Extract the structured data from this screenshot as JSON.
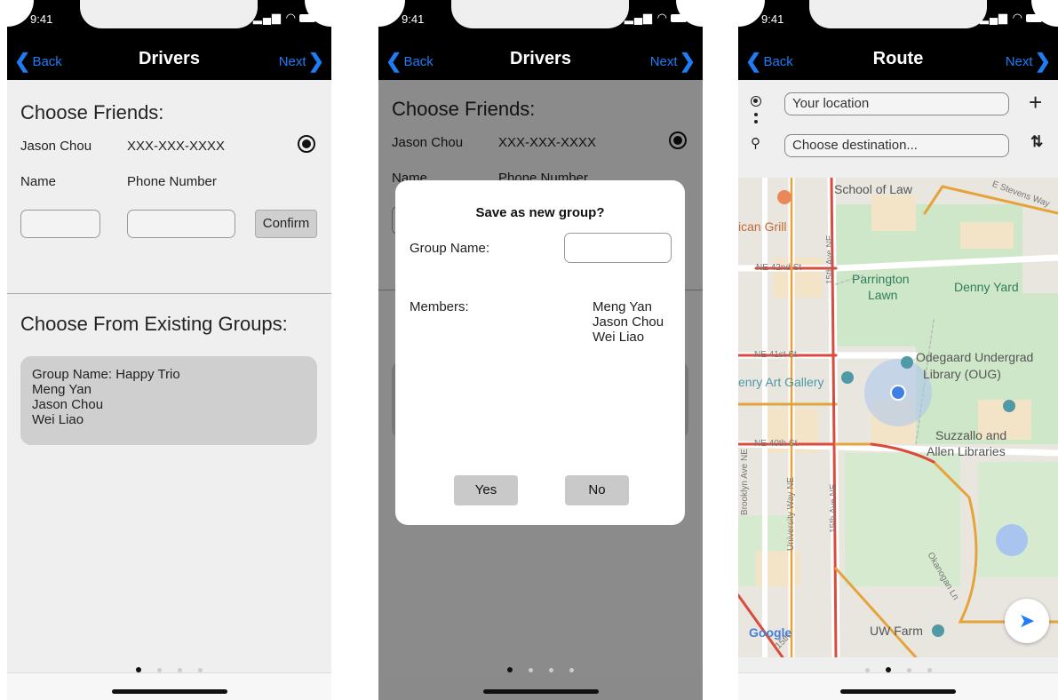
{
  "status": {
    "time": "9:41"
  },
  "phone1": {
    "nav": {
      "back": "Back",
      "title": "Drivers",
      "next": "Next"
    },
    "choose_friends_title": "Choose Friends:",
    "friend": {
      "name": "Jason Chou",
      "phone": "XXX-XXX-XXXX"
    },
    "labels": {
      "name": "Name",
      "phone": "Phone Number"
    },
    "confirm": "Confirm",
    "groups_title": "Choose From Existing Groups:",
    "group": {
      "line1": "Group Name: Happy Trio",
      "line2": "Meng Yan",
      "line3": "Jason Chou",
      "line4": "Wei Liao"
    }
  },
  "phone2": {
    "nav": {
      "back": "Back",
      "title": "Drivers",
      "next": "Next"
    },
    "choose_friends_title": "Choose Friends:",
    "friend": {
      "name": "Jason Chou",
      "phone": "XXX-XXX-XXXX"
    },
    "labels": {
      "name": "Name",
      "phone": "Phone Number"
    },
    "modal": {
      "title": "Save as new group?",
      "group_name_label": "Group Name:",
      "members_label": "Members:",
      "members": [
        "Meng Yan",
        "Jason Chou",
        "Wei Liao"
      ],
      "yes": "Yes",
      "no": "No"
    }
  },
  "phone3": {
    "nav": {
      "back": "Back",
      "title": "Route",
      "next": "Next"
    },
    "origin": "Your location",
    "destination": "Choose destination...",
    "map_labels": {
      "school_of_law": "School of Law",
      "grill": "ican Grill",
      "parrington": "Parrington",
      "lawn": "Lawn",
      "denny_yard": "Denny Yard",
      "odegaard1": "Odegaard Undergrad",
      "odegaard2": "Library (OUG)",
      "art_gallery": "enry Art Gallery",
      "suzzallo1": "Suzzallo and",
      "suzzallo2": "Allen Libraries",
      "uw_farm": "UW Farm",
      "google": "Google",
      "ne42": "NE 42nd St",
      "ne41": "NE 41st St",
      "ne40": "NE 40th St",
      "ave15": "15th Ave NE",
      "ave15b": "15th Ave NE",
      "university_way": "University Way NE",
      "brooklyn": "Brooklyn Ave NE",
      "okanogan": "Okanogan Ln",
      "stevens": "E Stevens Way",
      "fifteenth": "15th"
    }
  },
  "colors": {
    "accent": "#1e7cf5",
    "bar": "#000000"
  }
}
